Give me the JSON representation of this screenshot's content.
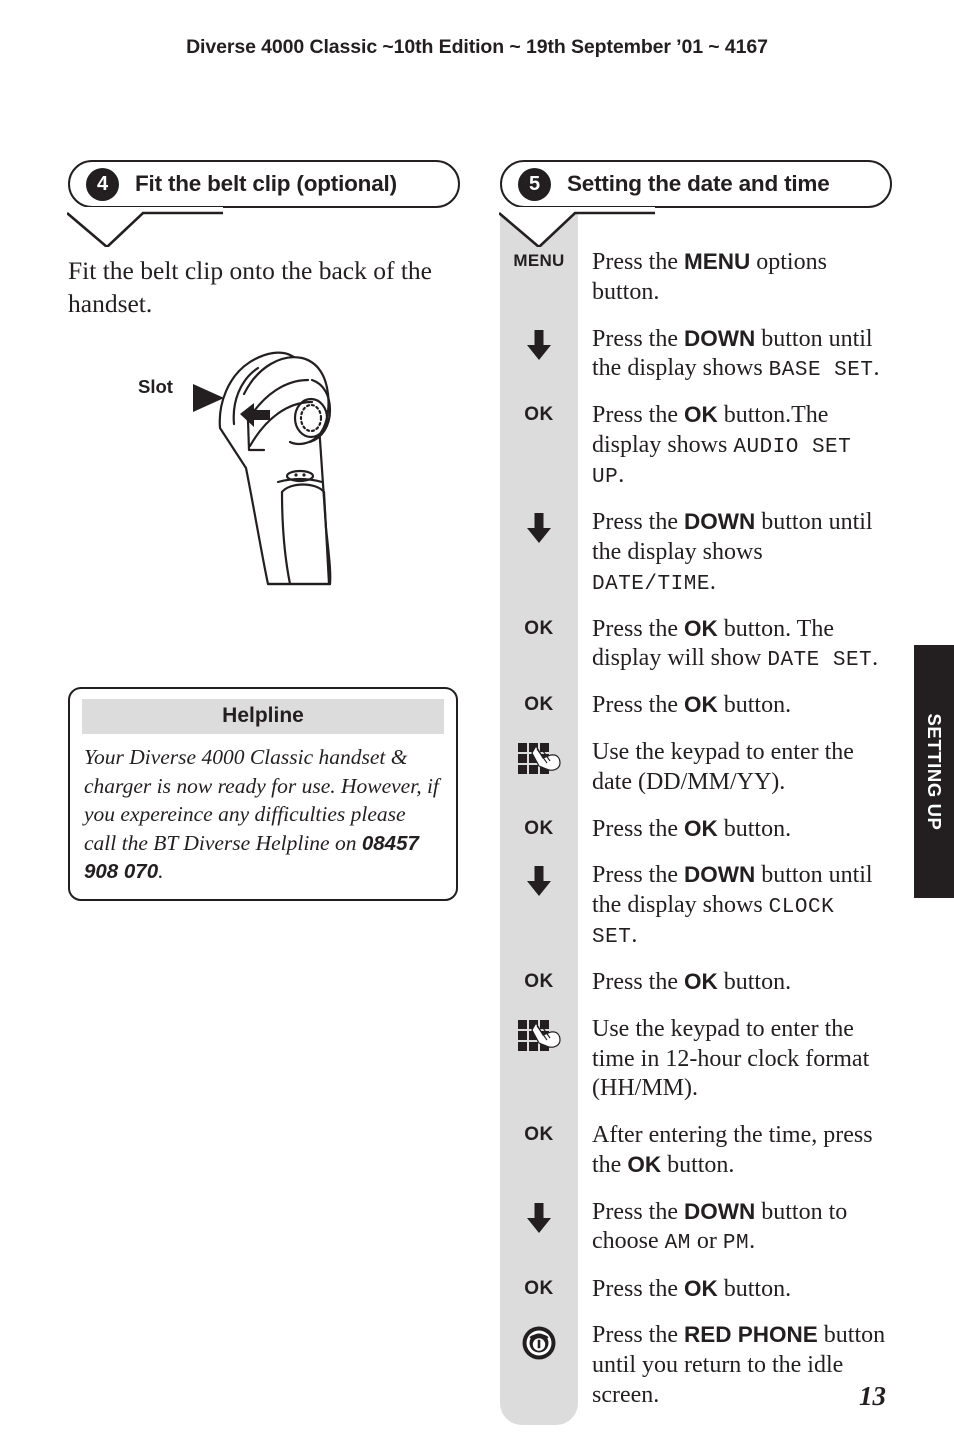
{
  "running_head": "Diverse 4000 Classic ~10th Edition ~ 19th September ’01 ~ 4167",
  "page_number": "13",
  "side_tab": {
    "label": "SETTING UP"
  },
  "left": {
    "section": {
      "number": "4",
      "title": "Fit the belt clip (optional)"
    },
    "lead_text": "Fit the belt clip onto the back of the handset.",
    "illustration": {
      "label": "Slot",
      "alt": "handset-back-with-belt-clip-slot"
    },
    "helpline": {
      "heading": "Helpline",
      "body_before": "Your Diverse 4000 Classic handset & charger is now ready for use. However, if you expereince any difficulties please call the BT Diverse Helpline on ",
      "phone": "08457 908 070",
      "body_after": "."
    }
  },
  "right": {
    "section": {
      "number": "5",
      "title": "Setting the date and time"
    },
    "steps": [
      {
        "icon": "menu-button-icon",
        "icon_label": "MENU",
        "text_parts": [
          {
            "t": "Press the ",
            "style": "normal"
          },
          {
            "t": "MENU",
            "style": "bold"
          },
          {
            "t": " options button.",
            "style": "normal"
          }
        ]
      },
      {
        "icon": "down-arrow-icon",
        "icon_label": "",
        "text_parts": [
          {
            "t": "Press the ",
            "style": "normal"
          },
          {
            "t": "DOWN",
            "style": "bold"
          },
          {
            "t": " button until the display shows ",
            "style": "normal"
          },
          {
            "t": "BASE SET",
            "style": "lcd"
          },
          {
            "t": ".",
            "style": "normal"
          }
        ]
      },
      {
        "icon": "ok-button-icon",
        "icon_label": "OK",
        "text_parts": [
          {
            "t": "Press the ",
            "style": "normal"
          },
          {
            "t": "OK",
            "style": "bold"
          },
          {
            "t": " button.The display shows ",
            "style": "normal"
          },
          {
            "t": "AUDIO SET UP",
            "style": "lcd"
          },
          {
            "t": ".",
            "style": "normal"
          }
        ]
      },
      {
        "icon": "down-arrow-icon",
        "icon_label": "",
        "text_parts": [
          {
            "t": "Press the ",
            "style": "normal"
          },
          {
            "t": "DOWN",
            "style": "bold"
          },
          {
            "t": " button until the display shows ",
            "style": "normal"
          },
          {
            "t": "DATE/TIME",
            "style": "lcd"
          },
          {
            "t": ".",
            "style": "normal"
          }
        ]
      },
      {
        "icon": "ok-button-icon",
        "icon_label": "OK",
        "text_parts": [
          {
            "t": "Press the ",
            "style": "normal"
          },
          {
            "t": "OK",
            "style": "bold"
          },
          {
            "t": " button. The display will show ",
            "style": "normal"
          },
          {
            "t": "DATE SET",
            "style": "lcd"
          },
          {
            "t": ".",
            "style": "normal"
          }
        ]
      },
      {
        "icon": "ok-button-icon",
        "icon_label": "OK",
        "text_parts": [
          {
            "t": "Press the ",
            "style": "normal"
          },
          {
            "t": "OK",
            "style": "bold"
          },
          {
            "t": " button.",
            "style": "normal"
          }
        ]
      },
      {
        "icon": "keypad-icon",
        "icon_label": "",
        "text_parts": [
          {
            "t": "Use the keypad to enter the date (DD/MM/YY).",
            "style": "normal"
          }
        ]
      },
      {
        "icon": "ok-button-icon",
        "icon_label": "OK",
        "text_parts": [
          {
            "t": "Press the ",
            "style": "normal"
          },
          {
            "t": "OK",
            "style": "bold"
          },
          {
            "t": " button.",
            "style": "normal"
          }
        ]
      },
      {
        "icon": "down-arrow-icon",
        "icon_label": "",
        "text_parts": [
          {
            "t": "Press the ",
            "style": "normal"
          },
          {
            "t": "DOWN",
            "style": "bold"
          },
          {
            "t": " button until the display shows ",
            "style": "normal"
          },
          {
            "t": "CLOCK SET",
            "style": "lcd"
          },
          {
            "t": ".",
            "style": "normal"
          }
        ]
      },
      {
        "icon": "ok-button-icon",
        "icon_label": "OK",
        "text_parts": [
          {
            "t": "Press the ",
            "style": "normal"
          },
          {
            "t": "OK",
            "style": "bold"
          },
          {
            "t": " button.",
            "style": "normal"
          }
        ]
      },
      {
        "icon": "keypad-icon",
        "icon_label": "",
        "text_parts": [
          {
            "t": "Use the keypad to enter the time in 12-hour clock format (HH/MM).",
            "style": "normal"
          }
        ]
      },
      {
        "icon": "ok-button-icon",
        "icon_label": "OK",
        "text_parts": [
          {
            "t": "After entering the time, press the ",
            "style": "normal"
          },
          {
            "t": "OK",
            "style": "bold"
          },
          {
            "t": " button.",
            "style": "normal"
          }
        ]
      },
      {
        "icon": "down-arrow-icon",
        "icon_label": "",
        "text_parts": [
          {
            "t": "Press the ",
            "style": "normal"
          },
          {
            "t": "DOWN",
            "style": "bold"
          },
          {
            "t": " button to choose ",
            "style": "normal"
          },
          {
            "t": "AM",
            "style": "lcd"
          },
          {
            "t": " or ",
            "style": "normal"
          },
          {
            "t": "PM",
            "style": "lcd"
          },
          {
            "t": ".",
            "style": "normal"
          }
        ]
      },
      {
        "icon": "ok-button-icon",
        "icon_label": "OK",
        "text_parts": [
          {
            "t": "Press the ",
            "style": "normal"
          },
          {
            "t": "OK",
            "style": "bold"
          },
          {
            "t": " button.",
            "style": "normal"
          }
        ]
      },
      {
        "icon": "red-phone-icon",
        "icon_label": "",
        "text_parts": [
          {
            "t": "Press the ",
            "style": "normal"
          },
          {
            "t": "RED PHONE",
            "style": "bold"
          },
          {
            "t": " button until you return to the idle screen.",
            "style": "normal"
          }
        ]
      }
    ]
  },
  "colors": {
    "ink": "#231f20",
    "rail_gray": "#dcdcdc",
    "tab_dark": "#231f20"
  }
}
